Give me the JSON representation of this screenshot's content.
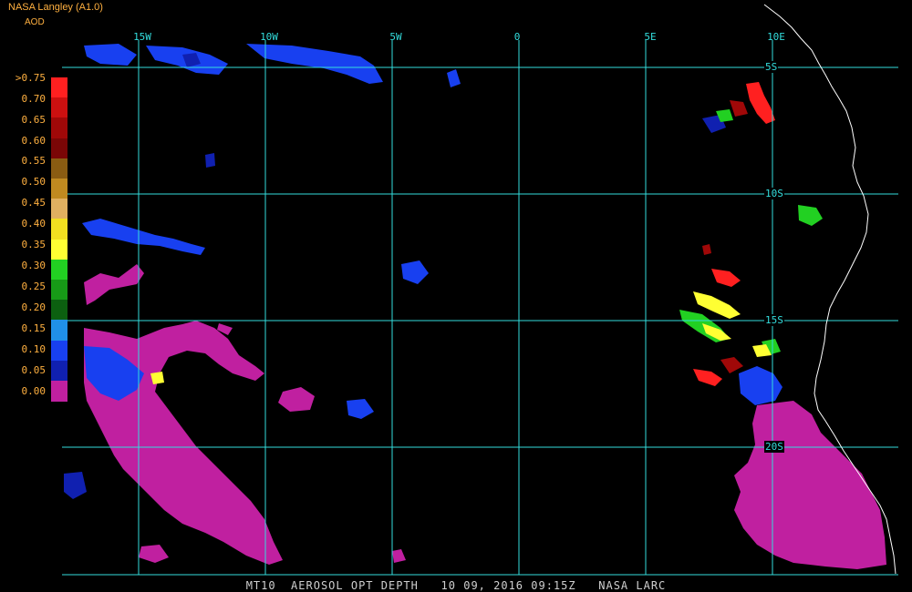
{
  "header": {
    "title": "NASA Langley (A1.0)",
    "product": "AOD"
  },
  "longitude_labels": [
    "15W",
    "10W",
    "5W",
    "0",
    "5E",
    "10E"
  ],
  "latitude_labels": [
    "5S",
    "10S",
    "15S",
    "20S"
  ],
  "legend": {
    "labels": [
      ">0.75",
      "0.70",
      "0.65",
      "0.60",
      "0.55",
      "0.50",
      "0.45",
      "0.40",
      "0.35",
      "0.30",
      "0.25",
      "0.20",
      "0.15",
      "0.10",
      "0.05",
      "0.00"
    ],
    "colors": [
      "#ff2020",
      "#cc1010",
      "#a00808",
      "#7a0606",
      "#8a5c12",
      "#c08a20",
      "#e0b060",
      "#f2e020",
      "#ffff33",
      "#22d022",
      "#179a17",
      "#0c6010",
      "#2090e8",
      "#1840f0",
      "#1020b0",
      "#c020a0"
    ]
  },
  "footer": "MT10  AEROSOL OPT DEPTH   10 09, 2016 09:15Z   NASA LARC",
  "colors": {
    "grid": "#33dddd",
    "coast": "#ffffff",
    "smoke_low": "#c020a0",
    "text_orange": "#ffb040"
  }
}
